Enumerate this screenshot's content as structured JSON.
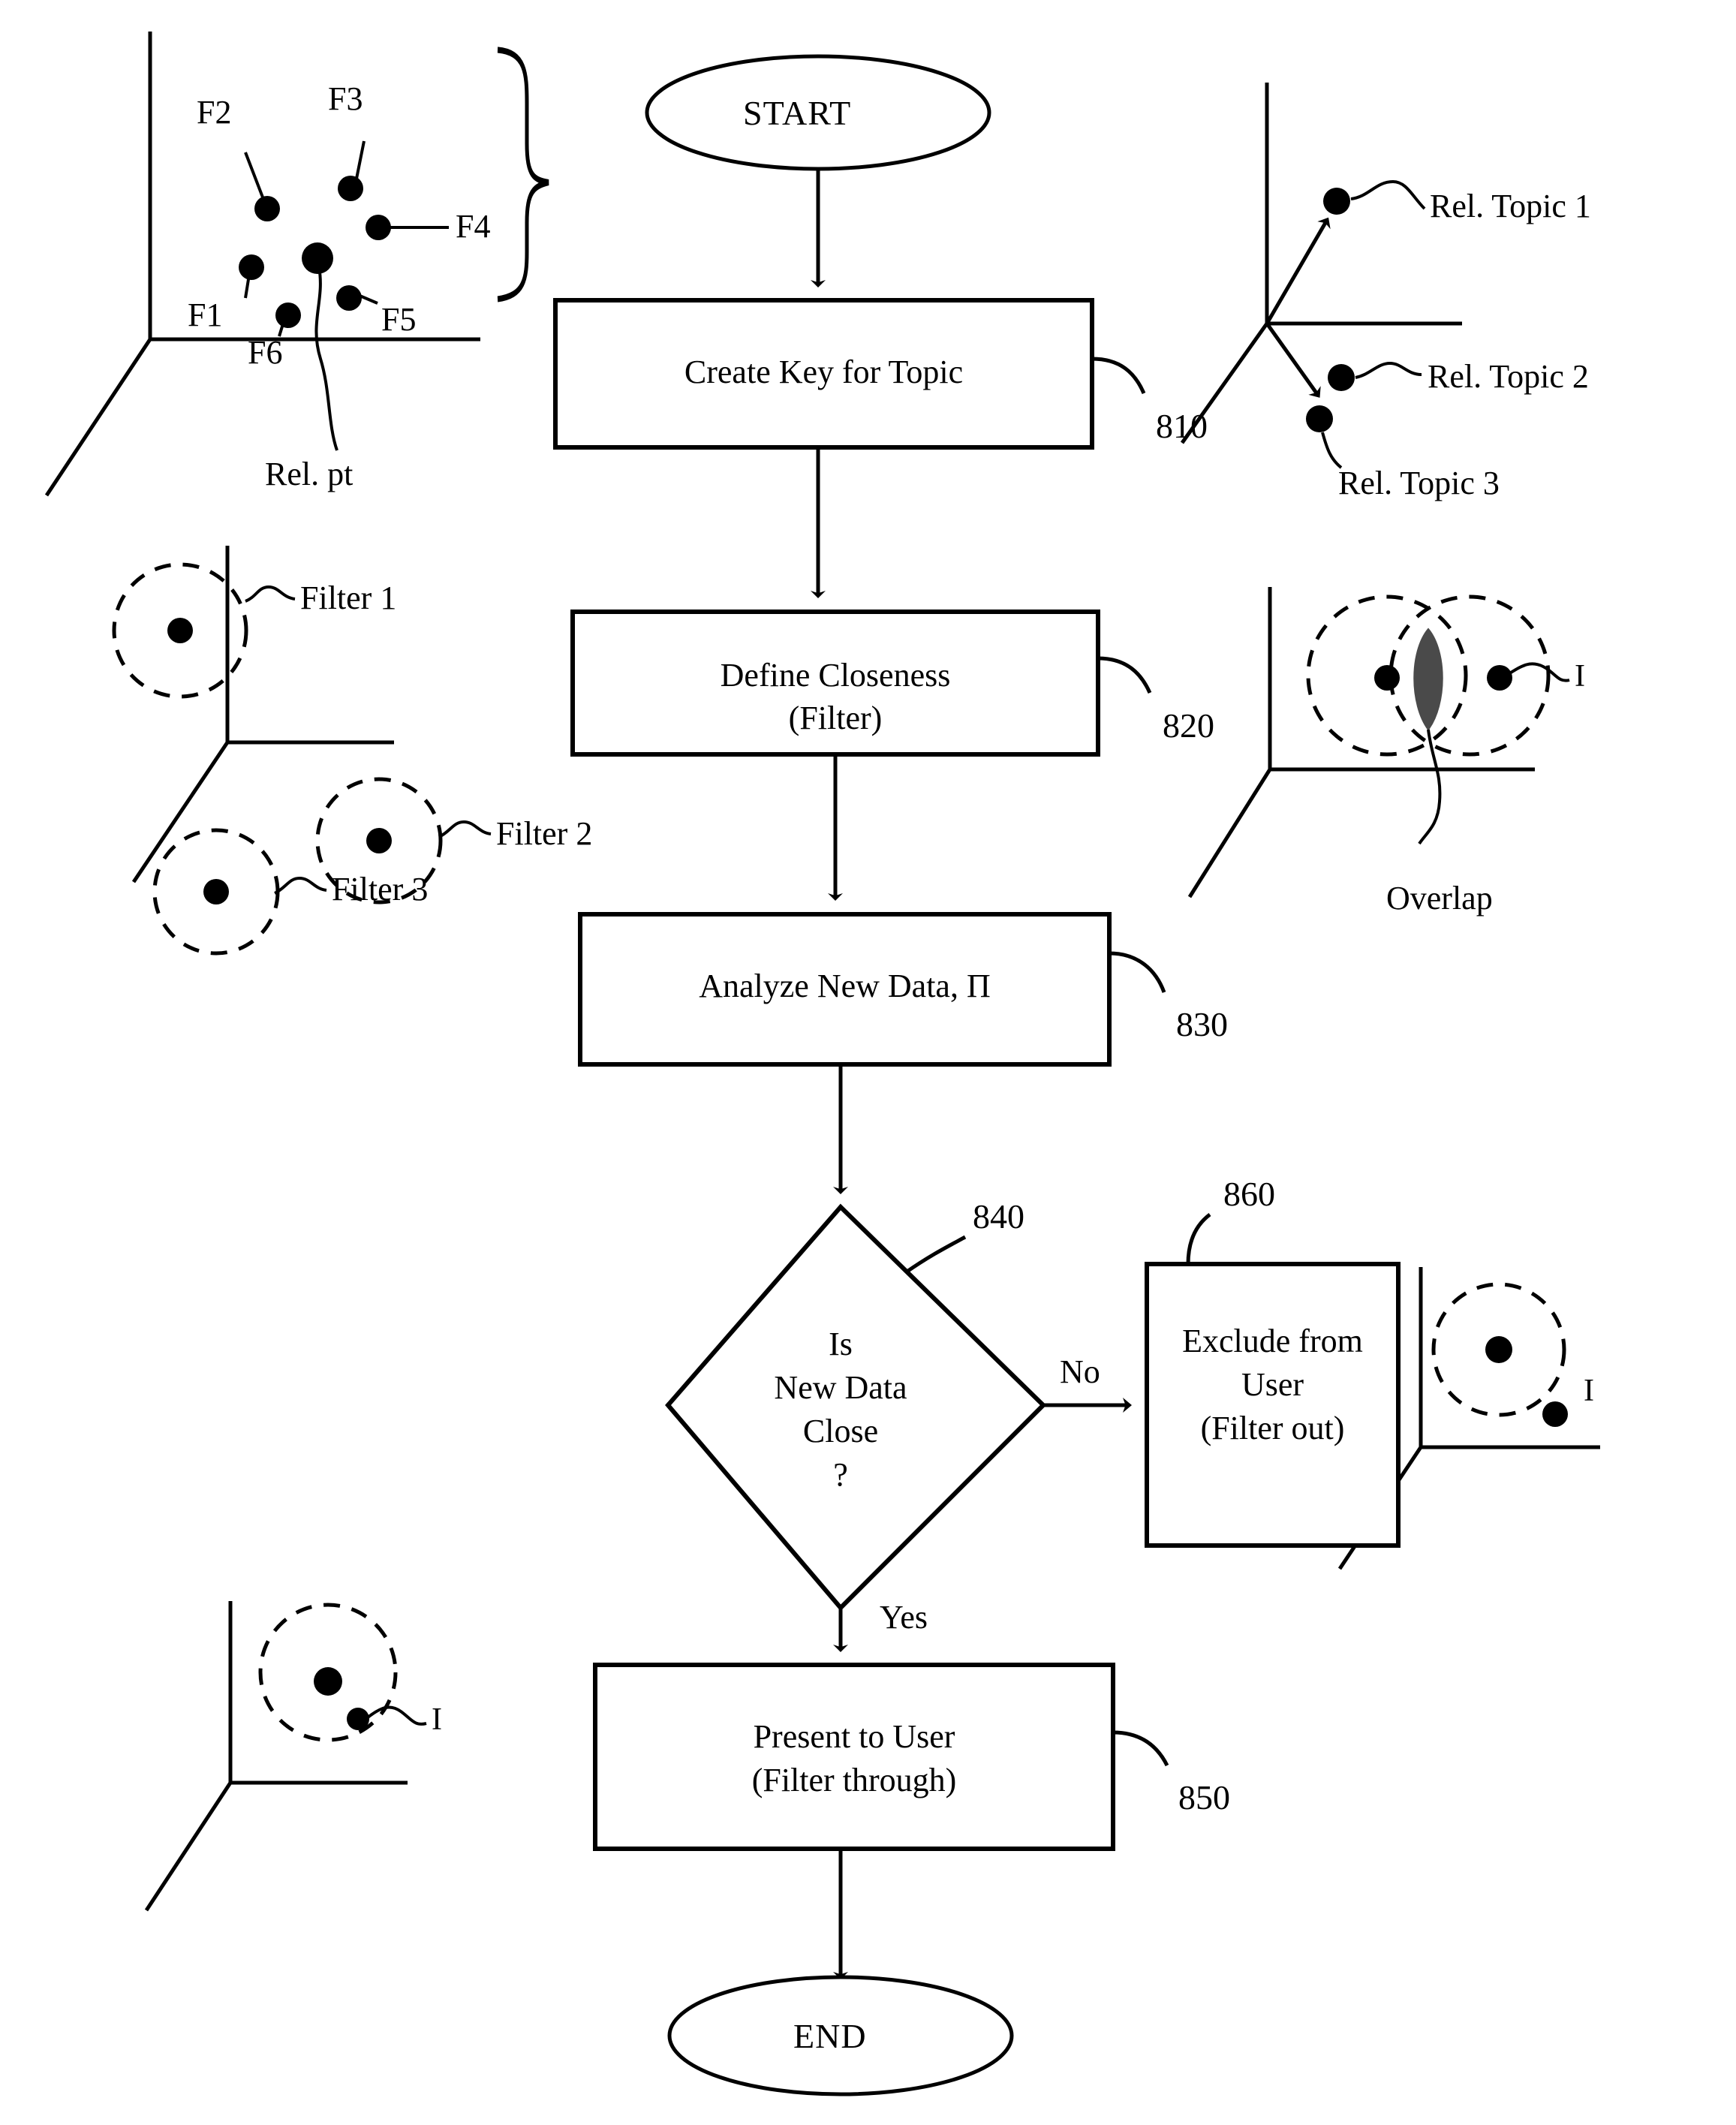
{
  "figure": {
    "type": "patent-flowchart",
    "title": "Topic key creation and closeness filtering flowchart"
  },
  "flow": {
    "start": {
      "label": "START"
    },
    "end": {
      "label": "END"
    },
    "nodes": [
      {
        "id": "810",
        "label_line1": "Create Key for Topic",
        "label_line2": "",
        "ref": "810",
        "shape": "process"
      },
      {
        "id": "820",
        "label_line1": "Define Closeness",
        "label_line2": "(Filter)",
        "ref": "820",
        "shape": "process"
      },
      {
        "id": "830",
        "label_line1": "Analyze New Data, Π",
        "label_line2": "",
        "ref": "830",
        "shape": "process"
      },
      {
        "id": "840",
        "label_line1": "Is",
        "label_line2": "New Data",
        "label_line3": "Close",
        "label_line4": "?",
        "ref": "840",
        "shape": "decision"
      },
      {
        "id": "860",
        "label_line1": "Exclude from",
        "label_line2": "User",
        "label_line3": "(Filter out)",
        "ref": "860",
        "shape": "process"
      },
      {
        "id": "850",
        "label_line1": "Present to User",
        "label_line2": "(Filter through)",
        "ref": "850",
        "shape": "process"
      }
    ],
    "edges": [
      {
        "from": "start",
        "to": "810",
        "label": ""
      },
      {
        "from": "810",
        "to": "820",
        "label": ""
      },
      {
        "from": "820",
        "to": "830",
        "label": ""
      },
      {
        "from": "830",
        "to": "840",
        "label": ""
      },
      {
        "from": "840",
        "to": "860",
        "label": "No"
      },
      {
        "from": "840",
        "to": "850",
        "label": "Yes"
      },
      {
        "from": "850",
        "to": "end",
        "label": ""
      }
    ]
  },
  "illustrations": {
    "feature_space": {
      "caption": "3D axes with feature points",
      "point_labels": [
        "F2",
        "F3",
        "F4",
        "F1",
        "F6",
        "F5"
      ],
      "relevance_point_label": "Rel. pt",
      "brace": true
    },
    "topic_axes": {
      "caption": "3D axes with relevant topic vectors",
      "labels": [
        "Rel. Topic 1",
        "Rel.  Topic 2",
        "Rel.  Topic 3"
      ]
    },
    "filters": {
      "caption": "3D axes with dashed filter spheres",
      "labels": [
        "Filter 1",
        "Filter 2",
        "Filter 3"
      ]
    },
    "overlap": {
      "caption": "Two overlapping dashed filter spheres",
      "overlap_label": "Overlap",
      "item_label": "I"
    },
    "filter_out": {
      "caption": "Item outside the dashed filter sphere",
      "item_label": "I"
    },
    "filter_through": {
      "caption": "Item inside the dashed filter sphere",
      "item_label": "I"
    }
  },
  "colors": {
    "ink": "#000000",
    "paper": "#ffffff",
    "overlap_fill": "#4a4a4a"
  }
}
